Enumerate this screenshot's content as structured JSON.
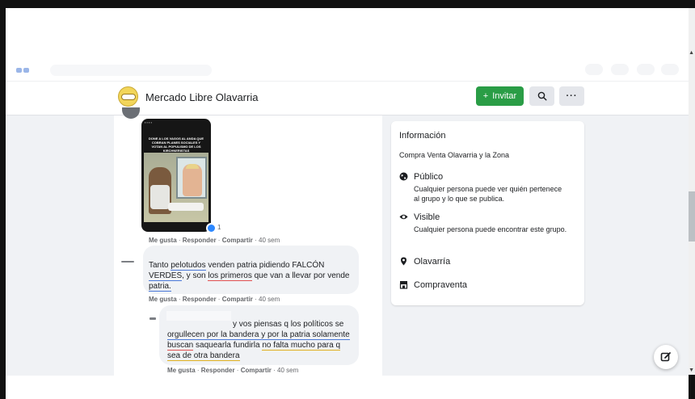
{
  "group": {
    "name": "Mercado Libre Olavarria",
    "invite_label": "Invitar",
    "invite_icon": "plus-icon",
    "search_icon": "search-icon",
    "more_label": "···"
  },
  "post": {
    "image_caption": "DONE A LOS VAGOS AL ANDA QUE COBRAN PLANES SOCIALES Y VOTAN AL POPULISMO DE LOS KIRCHNERISTAS",
    "reaction_count": "1",
    "actions": {
      "like": "Me gusta",
      "reply": "Responder",
      "share": "Compartir",
      "time": "40 sem"
    }
  },
  "comments": [
    {
      "text_parts": [
        "Tanto ",
        "pelotudos",
        " venden patria pidiendo FALCÓN",
        "VERDES",
        ", y son ",
        "los primeros",
        " que van a llevar por vende",
        "patria."
      ],
      "actions": {
        "like": "Me gusta",
        "reply": "Responder",
        "share": "Compartir",
        "time": "40 sem"
      }
    },
    {
      "line1": "y vos piensas q los políticos se",
      "line2_parts": [
        "orgullecen por la bandera y por la patria",
        " solamente"
      ],
      "line3_parts": [
        "buscan",
        " saquearla fundirla ",
        "no falta mucho para q"
      ],
      "line4": "sea de otra bandera",
      "actions": {
        "like": "Me gusta",
        "reply": "Responder",
        "share": "Compartir",
        "time": "40 sem"
      }
    }
  ],
  "info": {
    "title": "Información",
    "description": "Compra Venta Olavarria y la Zona",
    "items": [
      {
        "icon": "globe-icon",
        "head": "Público",
        "sub": "Cualquier persona puede ver quién pertenece al grupo y lo que se publica."
      },
      {
        "icon": "eye-icon",
        "head": "Visible",
        "sub": "Cualquier persona puede encontrar este grupo."
      },
      {
        "icon": "location-pin-icon",
        "head": "Olavarría",
        "sub": ""
      },
      {
        "icon": "store-icon",
        "head": "Compraventa",
        "sub": ""
      }
    ]
  },
  "colors": {
    "invite_green": "#2a9d46",
    "page_bg": "#f0f2f5",
    "reaction_blue": "#2d88ff"
  }
}
